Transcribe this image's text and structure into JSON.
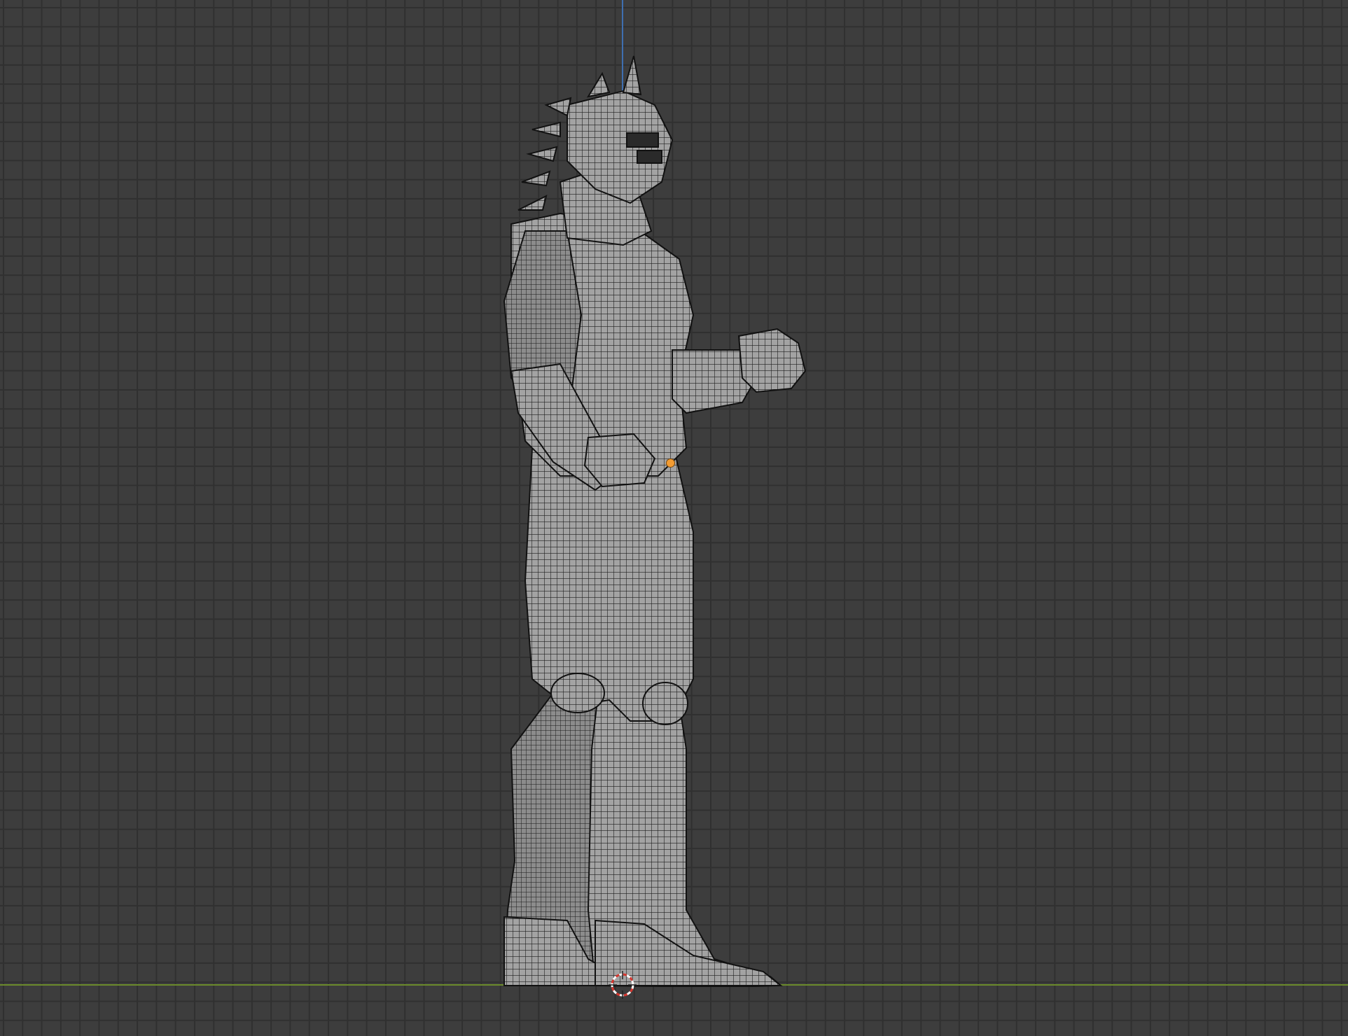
{
  "viewport": {
    "view": "side-orthographic",
    "shading": "wireframe-overlay",
    "colors": {
      "background": "#3d3d3d",
      "grid_line": "#303030",
      "z_axis": "#3f6fb0",
      "y_axis": "#6b8a2b",
      "mesh_fill": "#9a9a9a",
      "mesh_wire": "#1c1c1c",
      "origin": "#f39c32"
    }
  },
  "scene": {
    "object": "armored-character-mesh",
    "cursor_icon": "3d-cursor-icon",
    "origin_icon": "object-origin-icon"
  }
}
